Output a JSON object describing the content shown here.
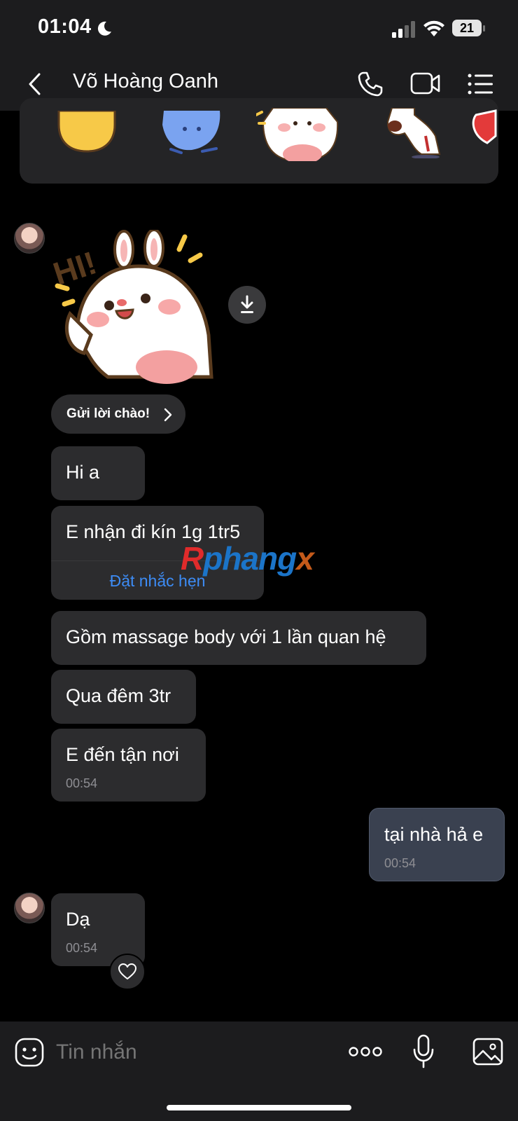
{
  "status_bar": {
    "time": "01:04",
    "battery_level": "21",
    "icons": [
      "moon-icon",
      "cellular-signal-icon",
      "wifi-icon",
      "battery-icon"
    ]
  },
  "header": {
    "back_icon": "chevron-left-icon",
    "contact_name": "Võ Hoàng Oanh",
    "actions": [
      "phone-icon",
      "video-call-icon",
      "menu-list-icon"
    ]
  },
  "sticker_suggestions": [
    "waving-hand-sticker",
    "blue-cat-sticker",
    "bunny-wave-sticker",
    "dog-bow-sticker",
    "heart-sticker"
  ],
  "messages": {
    "greeting_sticker": {
      "text": "HI!",
      "download_icon": "download-icon"
    },
    "greet_action": {
      "label": "Gửi lời chào!",
      "icon": "chevron-right-icon"
    },
    "m1": {
      "text": "Hi a"
    },
    "m2": {
      "text": "E nhận đi kín 1g 1tr5",
      "action": "Đặt nhắc hẹn"
    },
    "m3": {
      "text": "Gồm massage body với 1 lần quan hệ"
    },
    "m4": {
      "text": "Qua đêm 3tr"
    },
    "m5": {
      "text": "E đến tận nơi",
      "time": "00:54"
    },
    "m6": {
      "text": "tại nhà hả e",
      "time": "00:54"
    },
    "m7": {
      "text": "Dạ",
      "time": "00:54",
      "reaction_icon": "heart-outline-icon"
    }
  },
  "watermark": {
    "text_a": "R",
    "text_b": "phang",
    "text_c": "x"
  },
  "input_bar": {
    "placeholder": "Tin nhắn",
    "icons": [
      "emoji-icon",
      "more-dots-icon",
      "microphone-icon",
      "image-icon"
    ]
  },
  "colors": {
    "background": "#000000",
    "bar": "#1c1c1e",
    "bubble_in": "#2c2c2e",
    "bubble_out": "#3a4150",
    "link": "#3d8cf5"
  }
}
